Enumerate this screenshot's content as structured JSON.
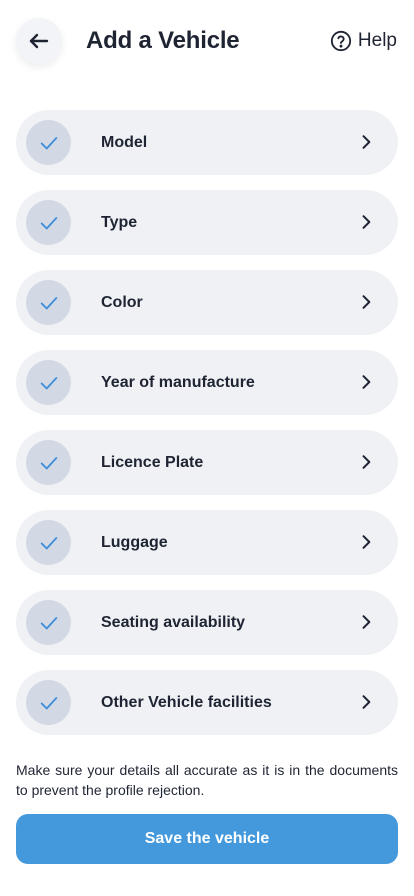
{
  "header": {
    "title": "Add a Vehicle",
    "help_label": "Help",
    "back_icon": "arrow-left-icon",
    "help_icon": "question-circle-icon"
  },
  "items": [
    {
      "label": "Model",
      "completed": true
    },
    {
      "label": "Type",
      "completed": true
    },
    {
      "label": "Color",
      "completed": true
    },
    {
      "label": "Year of manufacture",
      "completed": true
    },
    {
      "label": "Licence Plate",
      "completed": true
    },
    {
      "label": "Luggage",
      "completed": true
    },
    {
      "label": "Seating availability",
      "completed": true
    },
    {
      "label": "Other Vehicle facilities",
      "completed": true
    }
  ],
  "note": "Make sure your details all accurate as it is in the documents to prevent the profile rejection.",
  "save_button": {
    "label": "Save the vehicle"
  },
  "colors": {
    "accent": "#4499dc",
    "check_mark": "#3f8fd8",
    "item_background": "#eff1f5",
    "check_background": "#d3d9e4",
    "text": "#1f2433"
  }
}
